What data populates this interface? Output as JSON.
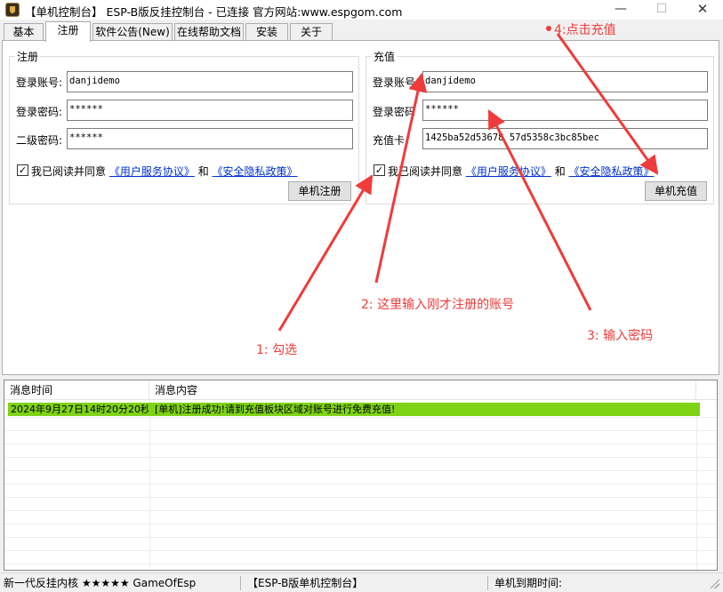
{
  "window": {
    "title": "【单机控制台】 ESP-B版反挂控制台 - 已连接   官方网站:www.espgom.com",
    "minimize": "—",
    "maximize": "☐",
    "close": "✕",
    "icon": "esp-app-icon"
  },
  "tabs": [
    {
      "label": "基本",
      "active": false
    },
    {
      "label": "注册",
      "active": true
    },
    {
      "label": "软件公告(New)",
      "active": false
    },
    {
      "label": "在线帮助文档",
      "active": false
    },
    {
      "label": "安装",
      "active": false
    },
    {
      "label": "关于",
      "active": false
    }
  ],
  "register": {
    "title": "注册",
    "account_label": "登录账号:",
    "account_value": "danjidemo",
    "password_label": "登录密码:",
    "password_value": "******",
    "password2_label": "二级密码:",
    "password2_value": "******",
    "agree_prefix": "我已阅读并同意",
    "agree_link1": "《用户服务协议》",
    "agree_and": "和",
    "agree_link2": "《安全隐私政策》",
    "agree_checked": true,
    "button": "单机注册"
  },
  "recharge": {
    "title": "充值",
    "account_label": "登录账号:",
    "account_value": "danjidemo",
    "password_label": "登录密码",
    "password_value": "******",
    "card_label": "充值卡",
    "card_value": "1425ba52d53678      57d5358c3bc85bec",
    "agree_prefix": "我已阅读并同意",
    "agree_link1": "《用户服务协议》",
    "agree_and": "和",
    "agree_link2": "《安全隐私政策》",
    "agree_checked": true,
    "button": "单机充值"
  },
  "log": {
    "columns": [
      "消息时间",
      "消息内容"
    ],
    "rows": [
      {
        "time": "2024年9月27日14时20分20秒",
        "message": "[单机]注册成功!请到充值板块区域对账号进行免费充值!"
      }
    ],
    "highlight_color": "#7fd315"
  },
  "statusbar": {
    "kernel": "新一代反挂内核 ★★★★★ GameOfEsp",
    "console": "【ESP-B版单机控制台】",
    "expiry": "单机到期时间:"
  },
  "annotations": {
    "color": "#ef3b3b",
    "step1": "1:  勾选",
    "step2": "2:  这里输入刚才注册的账号",
    "step3": "3:  输入密码",
    "step4": "4:点击充值"
  }
}
